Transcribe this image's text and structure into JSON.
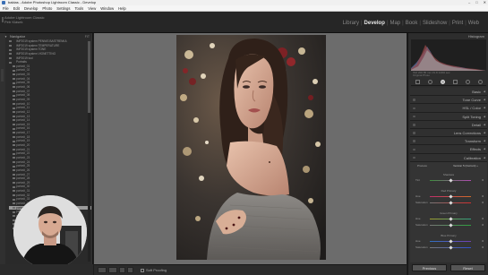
{
  "window": {
    "title": "baktas - Adobe Photoshop Lightroom Classic - Develop",
    "controls": [
      "–",
      "□",
      "✕"
    ]
  },
  "menu": [
    "File",
    "Edit",
    "Develop",
    "Photo",
    "Settings",
    "Tools",
    "View",
    "Window",
    "Help"
  ],
  "identity_plate": {
    "line1": "Adobe Lightroom Classic",
    "line2": "Petr Klásek"
  },
  "modules": {
    "items": [
      "Library",
      "Develop",
      "Map",
      "Book",
      "Slideshow",
      "Print",
      "Web"
    ],
    "active": "Develop"
  },
  "left_panel": {
    "header": "Navigator",
    "header_right": "FIT",
    "folders_top": [
      {
        "label": "IMP2019 system PENNIS BASTRENKA",
        "count": ""
      },
      {
        "label": "IMP2019 system TEMPERATURE",
        "count": ""
      },
      {
        "label": "IMP2019 system TONE",
        "count": ""
      },
      {
        "label": "IMP2019 system VIGNETTING",
        "count": ""
      },
      {
        "label": "IMP2019 tool",
        "count": ""
      },
      {
        "label": "Portraits",
        "count": ""
      }
    ],
    "presets": [
      "portrait_01",
      "portrait_02",
      "portrait_03",
      "portrait_04",
      "portrait_05",
      "portrait_06",
      "portrait_07",
      "portrait_08",
      "portrait_09",
      "portrait_10",
      "portrait_11",
      "portrait_12",
      "portrait_13",
      "portrait_14",
      "portrait_15",
      "portrait_16",
      "portrait_17",
      "portrait_18",
      "portrait_19",
      "portrait_20",
      "portrait_21",
      "portrait_22",
      "portrait_23",
      "portrait_24",
      "portrait_25",
      "portrait_26",
      "portrait_27",
      "portrait_28",
      "portrait_29",
      "portrait_30",
      "portrait_31",
      "portrait_32",
      "portrait_33",
      "portrait_34",
      "portrait_35",
      "portrait_36",
      "portrait_37",
      "portrait_38",
      "portrait_39",
      "portrait_40"
    ],
    "selected_index": 34
  },
  "toolbar": {
    "soft_proofing": "Soft Proofing"
  },
  "right_panel": {
    "histogram_label": "Histogram",
    "histogram_info": [
      "ISO 200   85 mm   f/1.8   1/200 sec",
      "Original Photo"
    ],
    "sections": [
      {
        "name": "Basic",
        "has_switch": false
      },
      {
        "name": "Tone Curve",
        "has_switch": true
      },
      {
        "name": "HSL / Color",
        "has_switch": true
      },
      {
        "name": "Split Toning",
        "has_switch": true
      },
      {
        "name": "Detail",
        "has_switch": true
      },
      {
        "name": "Lens Corrections",
        "has_switch": true
      },
      {
        "name": "Transform",
        "has_switch": true
      },
      {
        "name": "Effects",
        "has_switch": true
      },
      {
        "name": "Calibration",
        "has_switch": true
      }
    ],
    "calibration": {
      "process_label": "Process",
      "process_value": "Version 5 (Current) ÷",
      "groups": [
        {
          "title": "Shadows",
          "sliders": [
            {
              "label": "Tint",
              "value": "0",
              "level": 0.5,
              "track": "tint"
            }
          ]
        },
        {
          "title": "Red Primary",
          "sliders": [
            {
              "label": "Hue",
              "value": "0",
              "level": 0.5,
              "track": "redhue"
            },
            {
              "label": "Saturation",
              "value": "0",
              "level": 0.5,
              "track": "redsat"
            }
          ]
        },
        {
          "title": "Green Primary",
          "sliders": [
            {
              "label": "Hue",
              "value": "0",
              "level": 0.5,
              "track": "greenhue"
            },
            {
              "label": "Saturation",
              "value": "0",
              "level": 0.5,
              "track": "greensat"
            }
          ]
        },
        {
          "title": "Blue Primary",
          "sliders": [
            {
              "label": "Hue",
              "value": "0",
              "level": 0.5,
              "track": "bluehue"
            },
            {
              "label": "Saturation",
              "value": "0",
              "level": 0.5,
              "track": "bluesat"
            }
          ]
        }
      ]
    },
    "buttons": {
      "previous": "Previous",
      "reset": "Reset"
    }
  },
  "colors": {
    "accent_active_module": "#e6e6e6",
    "panel_bg": "#2d2d2d",
    "center_bg": "#6c6c6c",
    "selected_row": "#9a9a9a"
  }
}
